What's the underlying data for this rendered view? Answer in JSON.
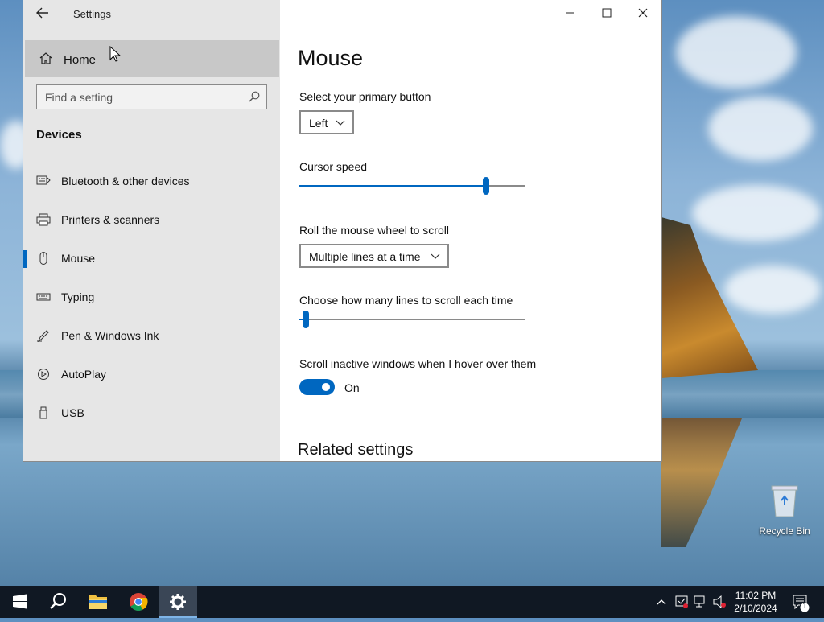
{
  "window": {
    "title": "Settings",
    "controls": {
      "minimize": "—",
      "maximize": "☐",
      "close": "✕"
    }
  },
  "sidebar": {
    "home_label": "Home",
    "search_placeholder": "Find a setting",
    "section_title": "Devices",
    "items": [
      {
        "label": "Bluetooth & other devices",
        "icon": "bluetooth-keyboard-icon"
      },
      {
        "label": "Printers & scanners",
        "icon": "printer-icon"
      },
      {
        "label": "Mouse",
        "icon": "mouse-icon",
        "active": true
      },
      {
        "label": "Typing",
        "icon": "keyboard-icon"
      },
      {
        "label": "Pen & Windows Ink",
        "icon": "pen-icon"
      },
      {
        "label": "AutoPlay",
        "icon": "autoplay-icon"
      },
      {
        "label": "USB",
        "icon": "usb-icon"
      }
    ]
  },
  "main": {
    "title": "Mouse",
    "primary_button": {
      "label": "Select your primary button",
      "value": "Left"
    },
    "cursor_speed": {
      "label": "Cursor speed",
      "value": 0.83
    },
    "wheel_scroll": {
      "label": "Roll the mouse wheel to scroll",
      "value": "Multiple lines at a time"
    },
    "lines_to_scroll": {
      "label": "Choose how many lines to scroll each time",
      "value": 0.03
    },
    "inactive_scroll": {
      "label": "Scroll inactive windows when I hover over them",
      "state": "On"
    },
    "related_title": "Related settings"
  },
  "desktop": {
    "recycle_bin_label": "Recycle Bin"
  },
  "taskbar": {
    "apps": [
      "windows-start-icon",
      "search-icon",
      "file-explorer-icon",
      "chrome-icon",
      "settings-icon"
    ],
    "time": "11:02 PM",
    "date": "2/10/2024",
    "notification_count": "1"
  },
  "colors": {
    "accent": "#0067c0",
    "sidebar_bg": "#e6e6e6",
    "home_bg": "#c8c8c8",
    "taskbar_bg": "#101823"
  }
}
